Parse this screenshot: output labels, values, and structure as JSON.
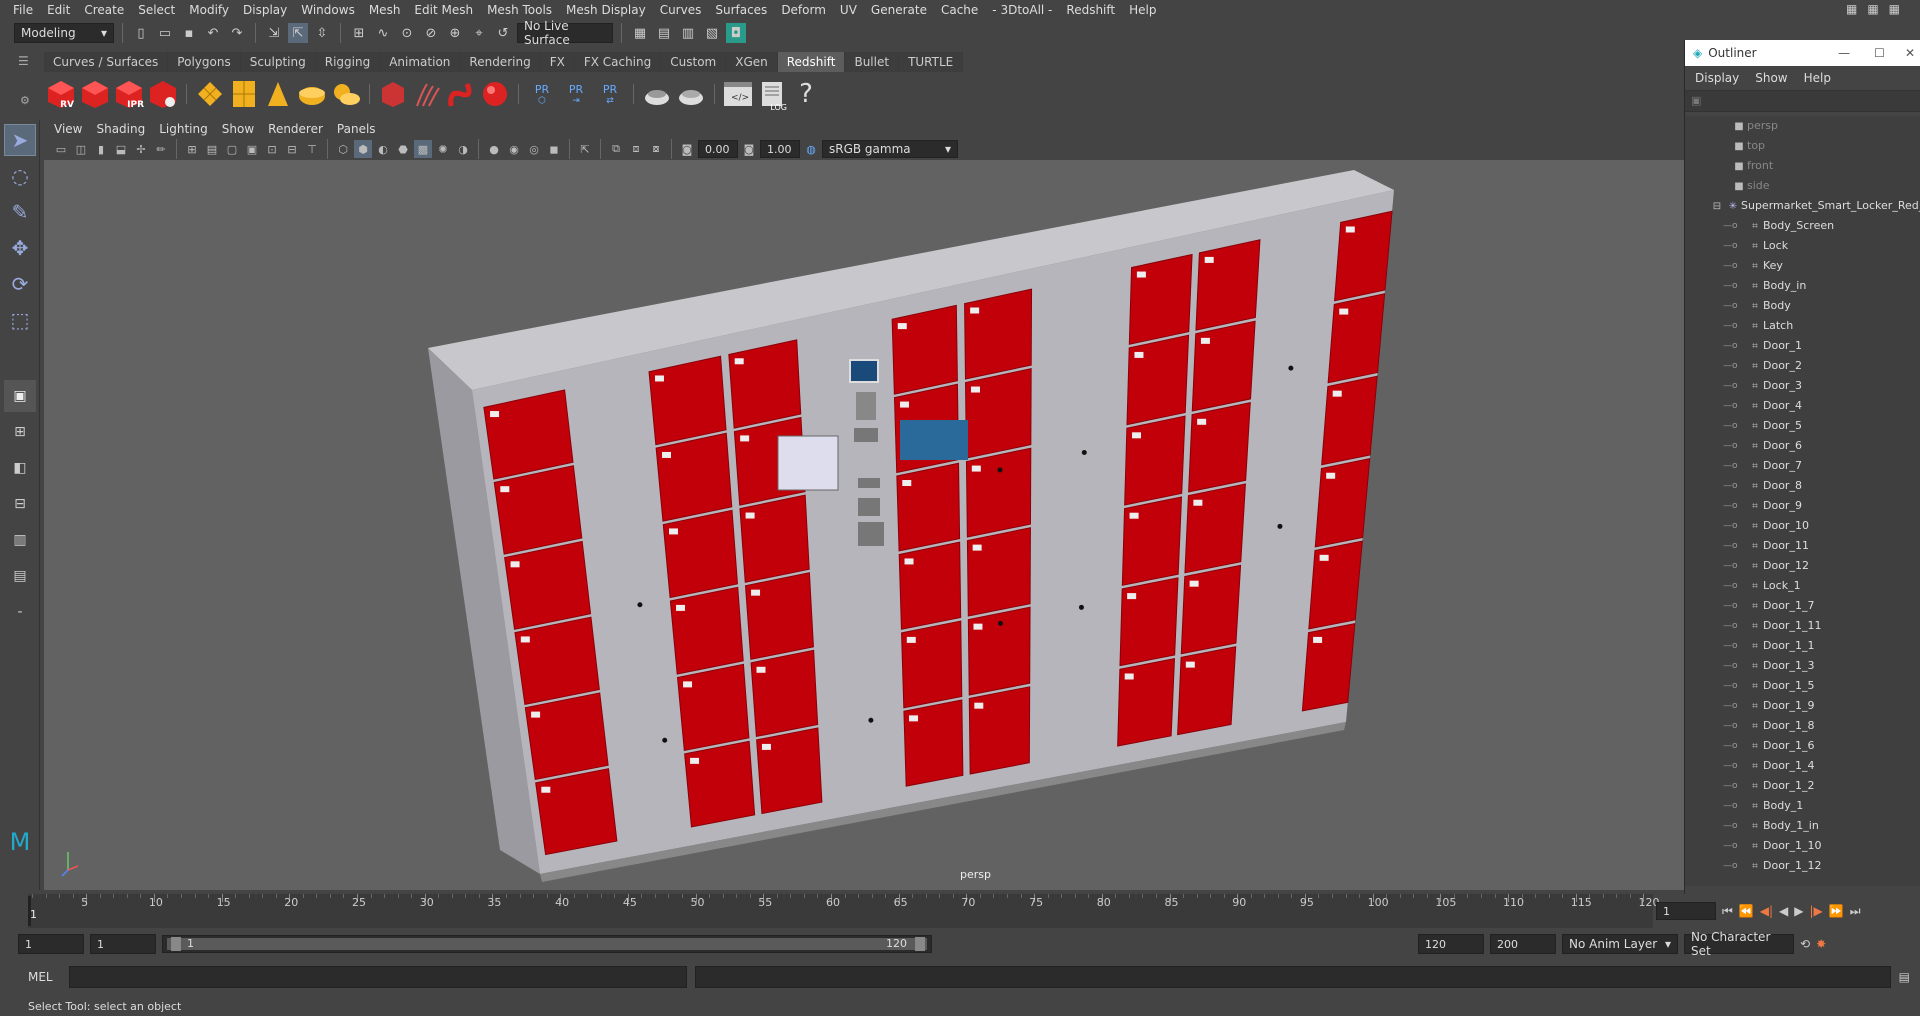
{
  "menubar": {
    "items": [
      "File",
      "Edit",
      "Create",
      "Select",
      "Modify",
      "Display",
      "Windows",
      "Mesh",
      "Edit Mesh",
      "Mesh Tools",
      "Mesh Display",
      "Curves",
      "Surfaces",
      "Deform",
      "UV",
      "Generate",
      "Cache",
      "- 3DtoAll -",
      "Redshift",
      "Help"
    ]
  },
  "statusline": {
    "workspace": "Modeling",
    "live_surface": "No Live Surface"
  },
  "shelf": {
    "tabs": [
      "Curves / Surfaces",
      "Polygons",
      "Sculpting",
      "Rigging",
      "Animation",
      "Rendering",
      "FX",
      "FX Caching",
      "Custom",
      "XGen",
      "Redshift",
      "Bullet",
      "TURTLE"
    ],
    "active_tab": "Redshift",
    "labels": {
      "rv": "RV",
      "ipr": "IPR",
      "pr1": "PR",
      "pr2": "PR",
      "pr3": "PR",
      "log": "LOG",
      "help": "?"
    }
  },
  "viewport": {
    "menu": [
      "View",
      "Shading",
      "Lighting",
      "Show",
      "Renderer",
      "Panels"
    ],
    "exposure": "0.00",
    "gamma": "1.00",
    "color_space": "sRGB gamma",
    "camera": "persp",
    "accent": "#c1000a"
  },
  "outliner": {
    "title": "Outliner",
    "menu": [
      "Display",
      "Show",
      "Help"
    ],
    "cameras": [
      "persp",
      "top",
      "front",
      "side"
    ],
    "root": "Supermarket_Smart_Locker_Red_m",
    "children": [
      "Body_Screen",
      "Lock",
      "Key",
      "Body_in",
      "Body",
      "Latch",
      "Door_1",
      "Door_2",
      "Door_3",
      "Door_4",
      "Door_5",
      "Door_6",
      "Door_7",
      "Door_8",
      "Door_9",
      "Door_10",
      "Door_11",
      "Door_12",
      "Lock_1",
      "Door_1_7",
      "Door_1_11",
      "Door_1_1",
      "Door_1_3",
      "Door_1_5",
      "Door_1_9",
      "Door_1_8",
      "Door_1_6",
      "Door_1_4",
      "Door_1_2",
      "Body_1",
      "Body_1_in",
      "Door_1_10",
      "Door_1_12"
    ]
  },
  "timeline": {
    "ticks": [
      "5",
      "10",
      "15",
      "20",
      "25",
      "30",
      "35",
      "40",
      "45",
      "50",
      "55",
      "60",
      "65",
      "70",
      "75",
      "80",
      "85",
      "90",
      "95",
      "100",
      "105",
      "110",
      "115",
      "120"
    ],
    "start_marker": "1",
    "current_frame": "1"
  },
  "range": {
    "start": "1",
    "start2": "1",
    "range_start": "1",
    "range_end": "120",
    "end": "120",
    "end2": "200",
    "anim_layer": "No Anim Layer",
    "char_set": "No Character Set"
  },
  "cmd": {
    "label": "MEL"
  },
  "help": {
    "text": "Select Tool: select an object"
  }
}
